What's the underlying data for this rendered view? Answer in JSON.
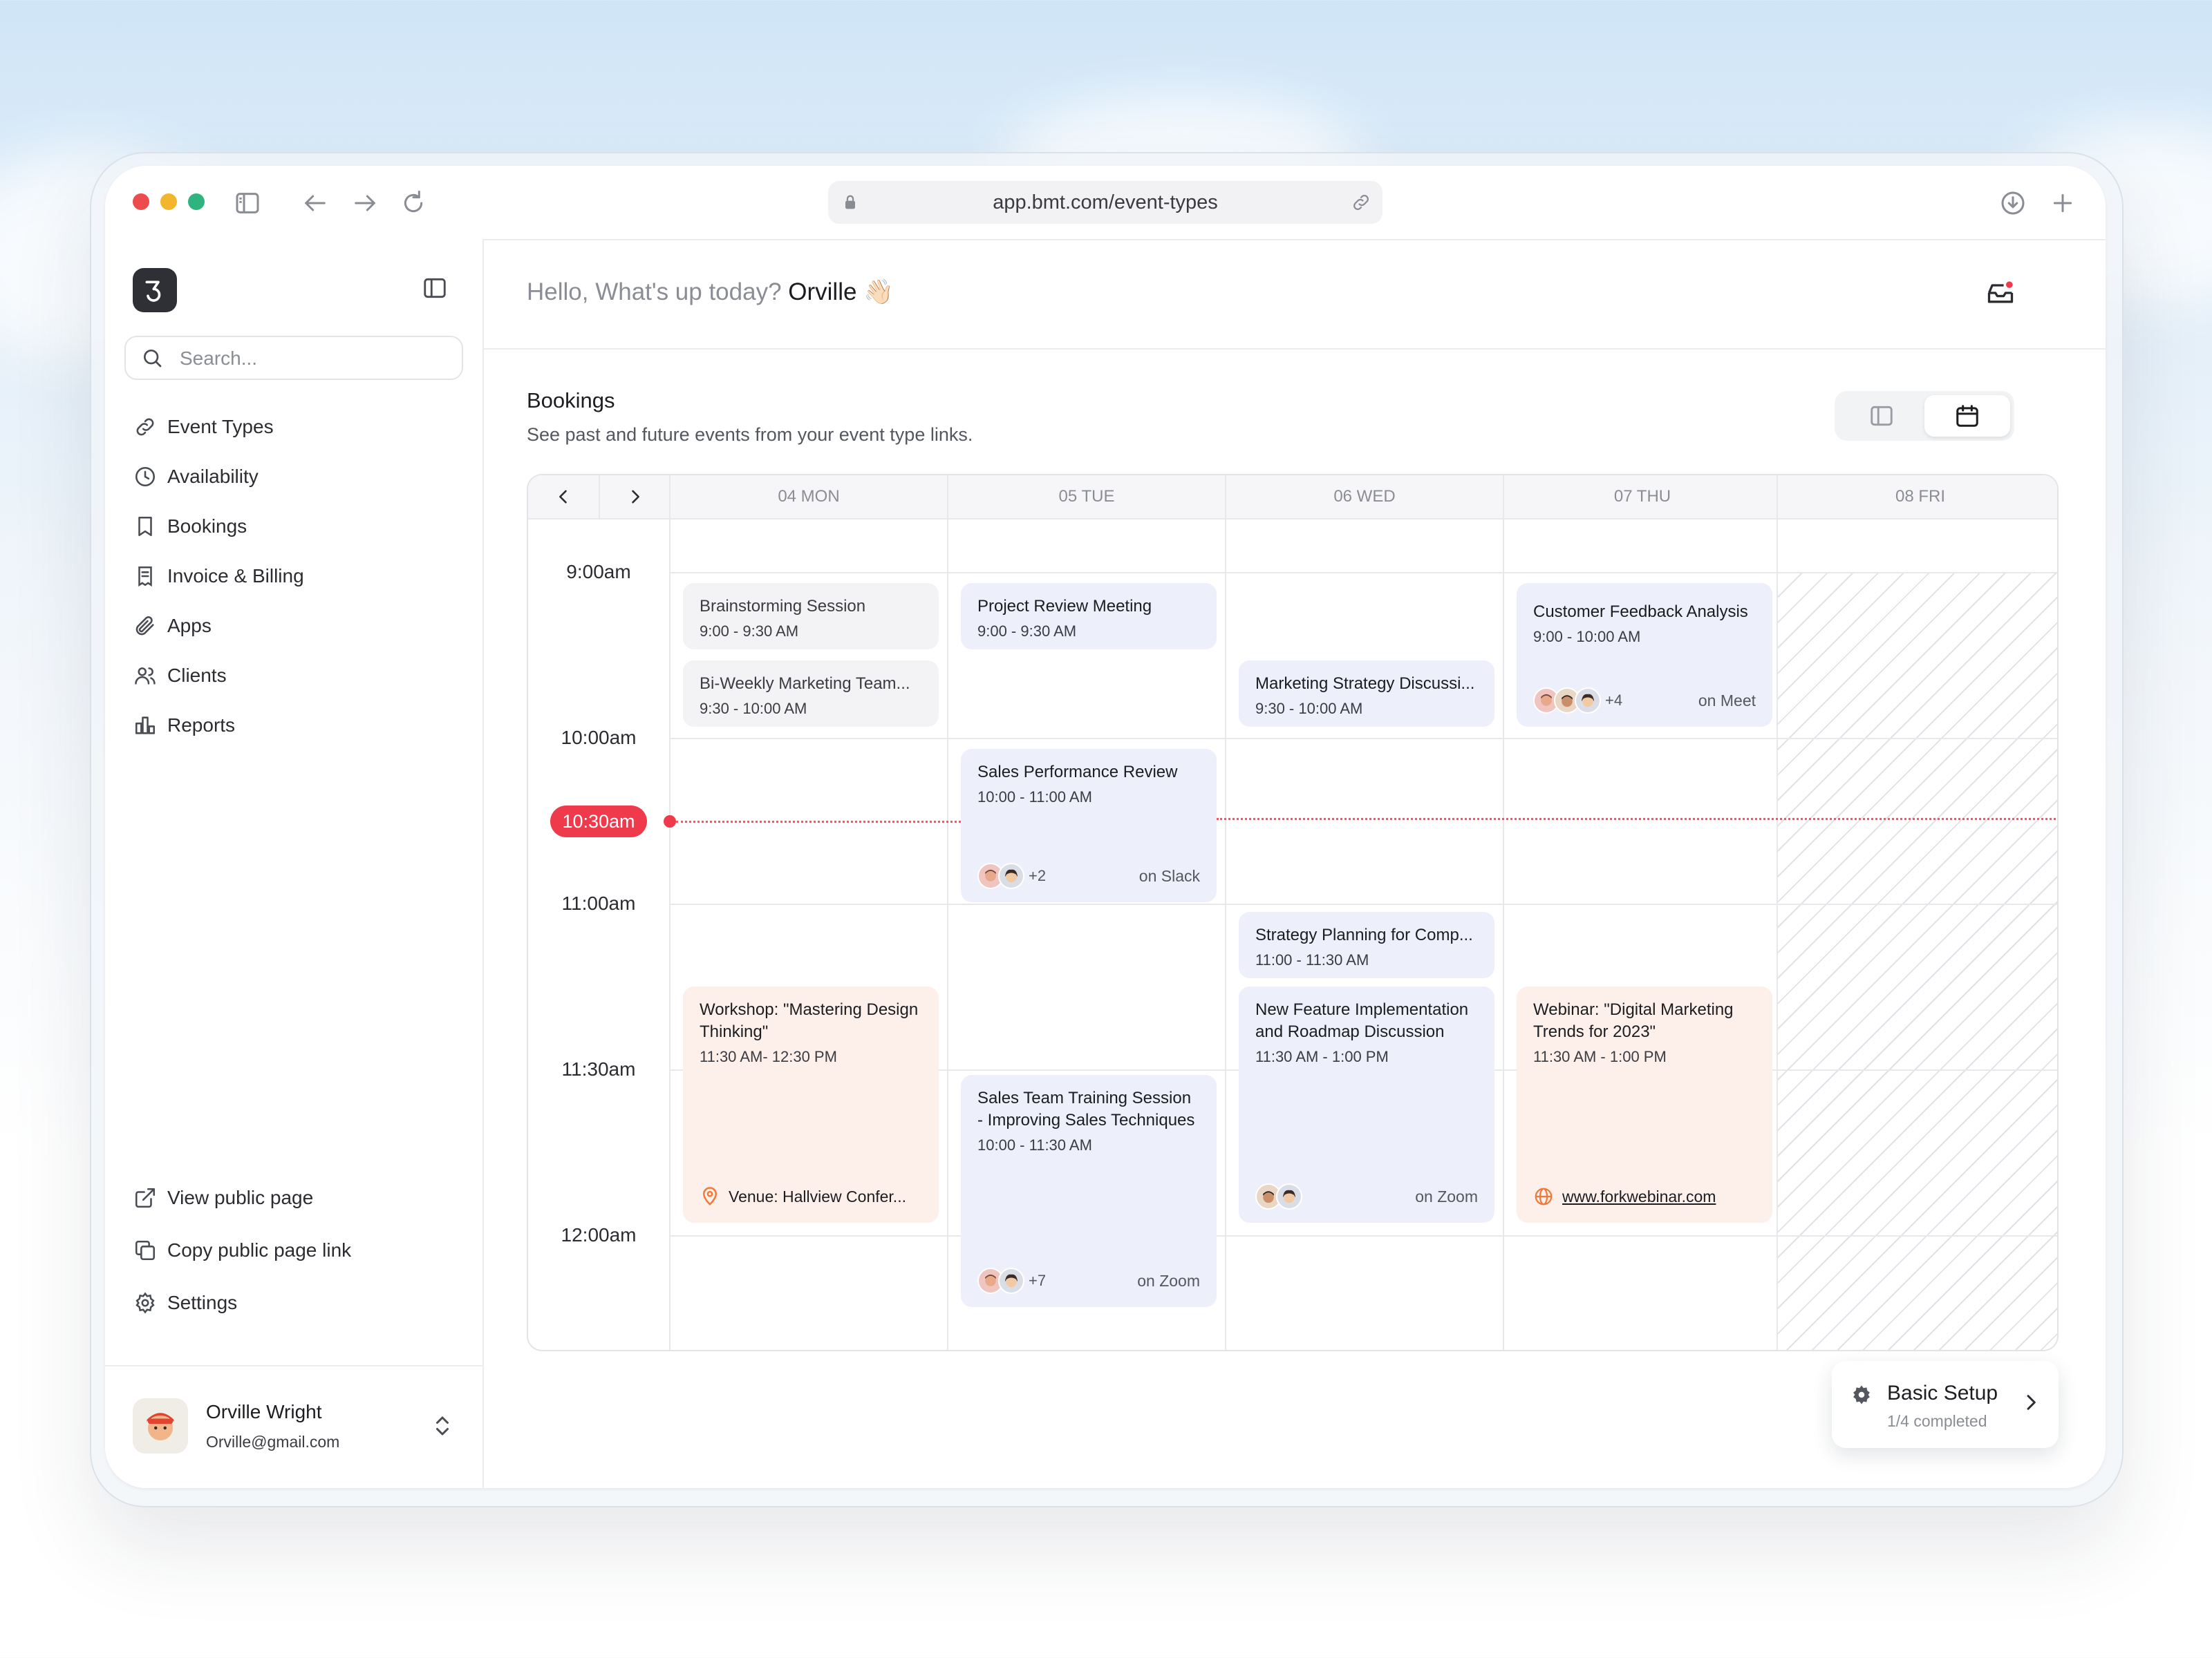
{
  "browser": {
    "url": "app.bmt.com/event-types"
  },
  "sidebar": {
    "search_placeholder": "Search...",
    "nav": [
      {
        "label": "Event Types",
        "icon": "link-icon"
      },
      {
        "label": "Availability",
        "icon": "clock-icon"
      },
      {
        "label": "Bookings",
        "icon": "bookmark-icon"
      },
      {
        "label": "Invoice & Billing",
        "icon": "invoice-icon"
      },
      {
        "label": "Apps",
        "icon": "paperclip-icon"
      },
      {
        "label": "Clients",
        "icon": "users-icon"
      },
      {
        "label": "Reports",
        "icon": "bar-chart-icon"
      }
    ],
    "bottom_links": [
      {
        "label": "View public page",
        "icon": "external-link-icon"
      },
      {
        "label": "Copy public page link",
        "icon": "copy-icon"
      },
      {
        "label": "Settings",
        "icon": "gear-icon"
      }
    ],
    "user": {
      "name": "Orville Wright",
      "email": "Orville@gmail.com"
    }
  },
  "header": {
    "greeting": "Hello, What's up today?",
    "name": "Orville",
    "emoji": "👋🏻"
  },
  "bookings": {
    "title": "Bookings",
    "subtitle": "See past and future events from your event type links."
  },
  "calendar": {
    "days": [
      "04 MON",
      "05 TUE",
      "06 WED",
      "07 THU",
      "08 FRI"
    ],
    "times": [
      "9:00am",
      "10:00am",
      "11:00am",
      "11:30am",
      "12:00am"
    ],
    "now_label": "10:30am",
    "events": [
      {
        "title": "Brainstorming Session",
        "time": "9:00 - 9:30 AM"
      },
      {
        "title": "Bi-Weekly Marketing Team...",
        "time": "9:30 - 10:00 AM"
      },
      {
        "title": "Workshop: \"Mastering Design Thinking\"",
        "time": "11:30 AM- 12:30 PM",
        "location": "Venue: Hallview Confer..."
      },
      {
        "title": "Project Review Meeting",
        "time": "9:00 - 9:30 AM"
      },
      {
        "title": "Sales Performance Review",
        "time": "10:00 - 11:00 AM",
        "more": "+2",
        "platform": "on Slack"
      },
      {
        "title": "Sales Team Training Session - Improving Sales Techniques",
        "time": "10:00 - 11:30 AM",
        "more": "+7",
        "platform": "on Zoom"
      },
      {
        "title": "Marketing Strategy Discussi...",
        "time": "9:30 - 10:00 AM"
      },
      {
        "title": "Strategy Planning for Comp...",
        "time": "11:00 - 11:30 AM"
      },
      {
        "title": "New Feature Implementation and Roadmap Discussion",
        "time": "11:30 AM - 1:00 PM",
        "platform": "on Zoom"
      },
      {
        "title": "Customer Feedback Analysis",
        "time": "9:00 - 10:00 AM",
        "more": "+4",
        "platform": "on Meet"
      },
      {
        "title": "Webinar: \"Digital Marketing Trends for 2023\"",
        "time": "11:30 AM - 1:00 PM",
        "link": "www.forkwebinar.com"
      }
    ]
  },
  "setup": {
    "title": "Basic Setup",
    "progress": "1/4 completed"
  },
  "colors": {
    "accent_red": "#ef3a4b",
    "event_blue": "#edeffb",
    "event_peach": "#fdf0ea",
    "event_gray": "#f3f3f5",
    "location_orange": "#f07a3a"
  }
}
